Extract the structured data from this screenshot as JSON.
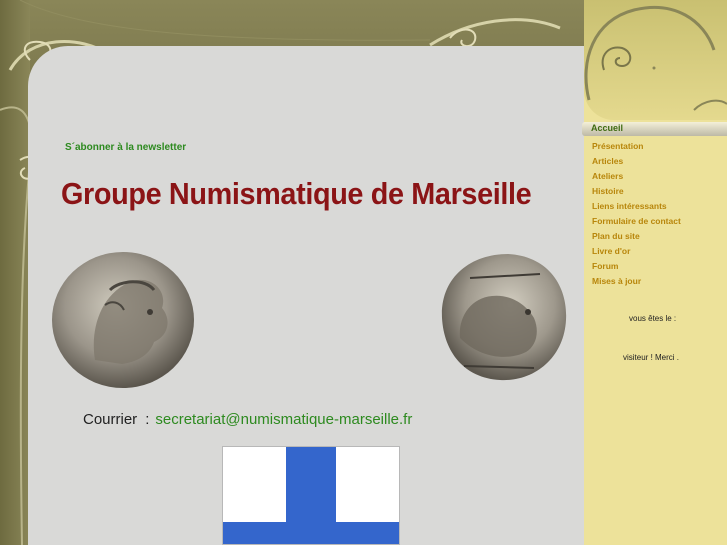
{
  "newsletter": {
    "label": "S´abonner à la newsletter"
  },
  "title": "Groupe Numismatique de Marseille",
  "contact": {
    "label": "Courrier",
    "separator": ":",
    "email": "secretariat@numismatique-marseille.fr"
  },
  "nav": {
    "active": "Accueil",
    "items": [
      "Présentation",
      "Articles",
      "Ateliers",
      "Histoire",
      "Liens intéressants",
      "Formulaire de contact",
      "Plan du site",
      "Livre d'or",
      "Forum",
      "Mises à jour"
    ]
  },
  "visitor": {
    "line1": "vous êtes le :",
    "line2": "visiteur ! Merci ."
  },
  "colors": {
    "title": "#8b1416",
    "link": "#2d8a1f",
    "nav": "#b8860b",
    "nav_active": "#3f6b12",
    "flag_blue": "#3466cc",
    "sidebar": "#ede29a",
    "panel": "#d9d9d7"
  },
  "images": {
    "coin_left": "silver-coin-artemis-head",
    "coin_right": "silver-coin-lion",
    "flag": "marseille-flag"
  }
}
